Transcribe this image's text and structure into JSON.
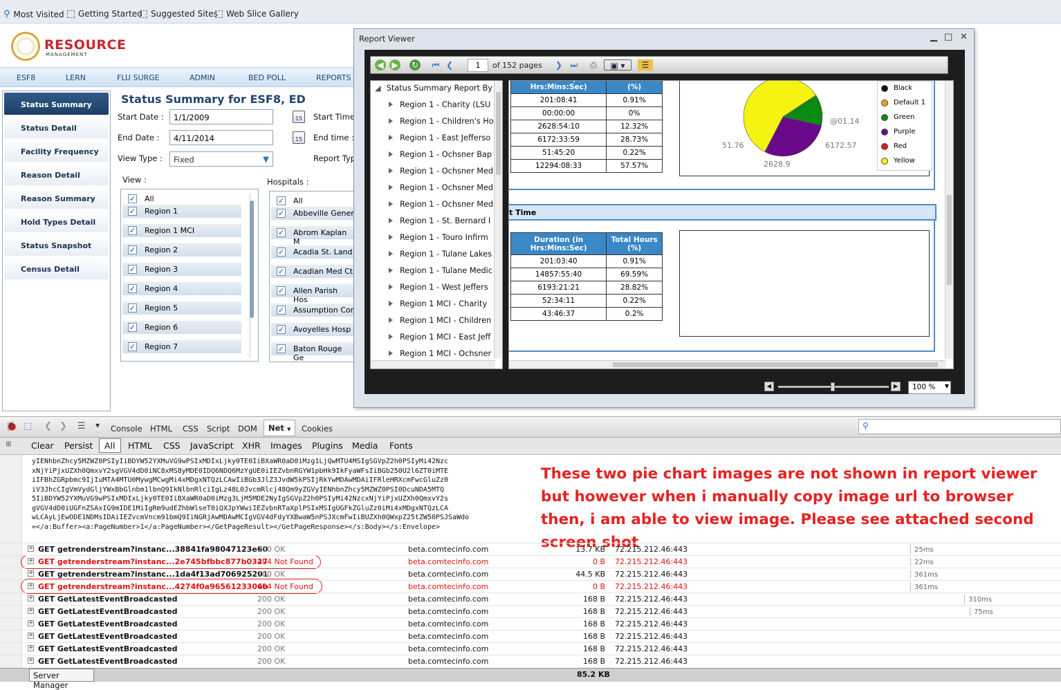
{
  "bookmarks": [
    "Most Visited",
    "Getting Started",
    "Suggested Sites",
    "Web Slice Gallery"
  ],
  "logo": {
    "title": "RESOURCE",
    "subtitle": "MANAGEMENT"
  },
  "menu": [
    "ESF8",
    "LERN",
    "FLU SURGE",
    "ADMIN",
    "BED POLL",
    "REPORTS"
  ],
  "nav": [
    "Status Summary",
    "Status Detail",
    "Facility Frequency",
    "Reason Detail",
    "Reason Summary",
    "Hold Types Detail",
    "Status Snapshot",
    "Census Detail"
  ],
  "page_title": "Status Summary for ESF8, ED",
  "form": {
    "start_date_label": "Start Date :",
    "start_date": "1/1/2009",
    "end_date_label": "End Date :",
    "end_date": "4/11/2014",
    "view_type_label": "View Type :",
    "view_type": "Fixed",
    "start_time_label": "Start Time",
    "end_time_label": "End time :",
    "report_type_label": "Report Typ",
    "calendar_day": "15",
    "view_label": "View :",
    "hospitals_label": "Hospitals :"
  },
  "view_list": [
    "All",
    "Region 1",
    "Region 1 MCI",
    "Region 2",
    "Region 3",
    "Region 4",
    "Region 5",
    "Region 6",
    "Region 7"
  ],
  "hospital_list": [
    "All",
    "Abbeville Gener",
    "Abrom Kaplan M",
    "Acadia St. Land",
    "Acadian Med Ct",
    "Allen Parish Hos",
    "Assumption Cor",
    "Avoyelles Hosp",
    "Baton Rouge Ge"
  ],
  "report_viewer": {
    "title": "Report Viewer",
    "page": "1",
    "page_of": "of 152 pages",
    "zoom": "100 %",
    "tree_root": "Status Summary Report By",
    "tree": [
      "Region 1 - Charity (LSU",
      "Region 1 - Children's Ho",
      "Region 1 - East Jefferso",
      "Region 1 - Ochsner Bap",
      "Region 1 - Ochsner Med",
      "Region 1 - Ochsner Med",
      "Region 1 - Ochsner Med",
      "Region 1 - St. Bernard I",
      "Region 1 - Touro Infirm",
      "Region 1 - Tulane Lakes",
      "Region 1 - Tulane Medic",
      "Region 1 - West Jeffers",
      "Region 1 MCI - Charity",
      "Region 1 MCI - Children",
      "Region 1 MCI - East Jeff",
      "Region 1 MCI - Ochsner"
    ],
    "table1": {
      "h1": "Duration (in Hrs:Mins:Sec)",
      "h2": "Total Hours (%)",
      "rows": [
        [
          "201:08:41",
          "0.91%"
        ],
        [
          "00:00:00",
          "0%"
        ],
        [
          "2628:54:10",
          "12.32%"
        ],
        [
          "6172:33:59",
          "28.73%"
        ],
        [
          "51:45:20",
          "0.22%"
        ],
        [
          "12294:08:33",
          "57.57%"
        ]
      ]
    },
    "section2_title": "t Time",
    "table2": {
      "h1": "Duration (in Hrs:Mins:Sec)",
      "h2": "Total Hours (%)",
      "rows": [
        [
          "201:03:40",
          "0.91%"
        ],
        [
          "14857:55:40",
          "69.59%"
        ],
        [
          "6193:21:21",
          "28.82%"
        ],
        [
          "52:34:11",
          "0.22%"
        ],
        [
          "43:46:37",
          "0.2%"
        ]
      ]
    },
    "pie_labels": [
      "@01.14",
      "2628.9",
      "6172.57",
      "51.76"
    ],
    "legend": [
      {
        "name": "Black",
        "color": "#111111"
      },
      {
        "name": "Default 1",
        "color": "#f0a020"
      },
      {
        "name": "Green",
        "color": "#0a8a10"
      },
      {
        "name": "Purple",
        "color": "#6a0a8a"
      },
      {
        "name": "Red",
        "color": "#e01818"
      },
      {
        "name": "Yellow",
        "color": "#f4f410"
      }
    ]
  },
  "chart_data": {
    "type": "pie",
    "categories": [
      "Yellow",
      "Purple",
      "Green",
      "Default 1"
    ],
    "values": [
      12294.14,
      6172.57,
      2628.9,
      51.76
    ],
    "data_labels": [
      "@01.14",
      "6172.57",
      "2628.9",
      "51.76"
    ]
  },
  "devtools": {
    "tabs": [
      "Console",
      "HTML",
      "CSS",
      "Script",
      "DOM",
      "Net",
      "Cookies"
    ],
    "filters": [
      "Clear",
      "Persist",
      "All",
      "HTML",
      "CSS",
      "JavaScript",
      "XHR",
      "Images",
      "Plugins",
      "Media",
      "Fonts"
    ],
    "response_lines": [
      "yIENhbnZhcy5MZWZ0PSIyIiBDYW52YXMuVG9wPSIxMDIxLjky0TE0IiBXaWR0aD0iMzg1LjQwMTU4MSIgSGVpZ2h0PSIyMi42Nzc",
      "xNjYiPjxUZXh0QmxvY2sgVGV4dD0iNC8xMS8yMDE0IDQ6NDQ6MzYgUE0iIEZvbnRGYW1pbHk9IkFyaWFsIiBGb250U2l6ZT0iMTE",
      "iIFBhZGRpbmc9IjIuMTA4MTU0MywgMCwgMi4xMDgxNTQzLCAwIiBGb3JlZ3JvdW5kPSIjRkYwMDAwMDAiIFRleHRXcmFwcGluZz0",
      "iV3JhcCIgVmVydGljYWxBbGlnbm1lbnQ9IkNlbnRlciIgLz48L0JvcmRlcj48Qm9yZGVyIENhbnZhcy5MZWZ0PSI0DcuNDA5MTQ",
      "5IiBDYW52YXMuVG9wPSIxMDIxLjky0TE0IiBXaWR0aD0iMzg3LjM5MDE2NyIgSGVpZ2h0PSIyMi42NzcxNjYiPjxUZXh0QmxvY2s",
      "gVGV4dD0iUGFnZSAxIG9mIDE1MiIgRm9udEZhbWlseT0iQXJpYWwiIEZvbnRTaXplPSIxMSIgUGFkZGluZz0iMi4xMDgxNTQzLCA",
      "wLCAyLjEwODE1NDMsIDAiIEZvcmVncm91bmQ9IiNGRjAwMDAwMCIgVGV4dFdyYXBwaW5nPSJXcmFwIiBUZXh0QWxpZ25tZW50PSJSaWdo",
      "=</a:Buffer><a:PageNumber>1</a:PageNumber></GetPageResult></GetPageResponse></s:Body></s:Envelope>"
    ],
    "note": "These two pie chart images are not shown in report viewer but however when i manually copy image url to browser then, i am able to view image. Please see attached second screen shot",
    "requests": [
      {
        "url": "GET getrenderstream?instanc...38841fa98047123e60",
        "status": "200 OK",
        "domain": "beta.comtecinfo.com",
        "size": "13.7 KB",
        "ip": "72.215.212.46:443",
        "time": "25ms",
        "err": false
      },
      {
        "url": "GET getrenderstream?instanc...2e745bfbbc877b0327",
        "status": "404 Not Found",
        "domain": "beta.comtecinfo.com",
        "size": "0 B",
        "ip": "72.215.212.46:443",
        "time": "22ms",
        "err": true
      },
      {
        "url": "GET getrenderstream?instanc...1da4f13ad706925201",
        "status": "200 OK",
        "domain": "beta.comtecinfo.com",
        "size": "44.5 KB",
        "ip": "72.215.212.46:443",
        "time": "361ms",
        "err": false
      },
      {
        "url": "GET getrenderstream?instanc...4274f0a9656123306b",
        "status": "404 Not Found",
        "domain": "beta.comtecinfo.com",
        "size": "0 B",
        "ip": "72.215.212.46:443",
        "time": "361ms",
        "err": true
      },
      {
        "url": "GET GetLatestEventBroadcasted",
        "status": "200 OK",
        "domain": "beta.comtecinfo.com",
        "size": "168 B",
        "ip": "72.215.212.46:443",
        "time": "310ms",
        "err": false
      },
      {
        "url": "GET GetLatestEventBroadcasted",
        "status": "200 OK",
        "domain": "beta.comtecinfo.com",
        "size": "168 B",
        "ip": "72.215.212.46:443",
        "time": "75ms",
        "err": false
      },
      {
        "url": "GET GetLatestEventBroadcasted",
        "status": "200 OK",
        "domain": "beta.comtecinfo.com",
        "size": "168 B",
        "ip": "72.215.212.46:443",
        "time": "",
        "err": false
      },
      {
        "url": "GET GetLatestEventBroadcasted",
        "status": "200 OK",
        "domain": "beta.comtecinfo.com",
        "size": "168 B",
        "ip": "72.215.212.46:443",
        "time": "",
        "err": false
      },
      {
        "url": "GET GetLatestEventBroadcasted",
        "status": "200 OK",
        "domain": "beta.comtecinfo.com",
        "size": "168 B",
        "ip": "72.215.212.46:443",
        "time": "",
        "err": false
      },
      {
        "url": "GET GetLatestEventBroadcasted",
        "status": "200 OK",
        "domain": "beta.comtecinfo.com",
        "size": "168 B",
        "ip": "72.215.212.46:443",
        "time": "",
        "err": false
      }
    ],
    "total": "85.2 KB",
    "taskbar": "Server Manager"
  }
}
